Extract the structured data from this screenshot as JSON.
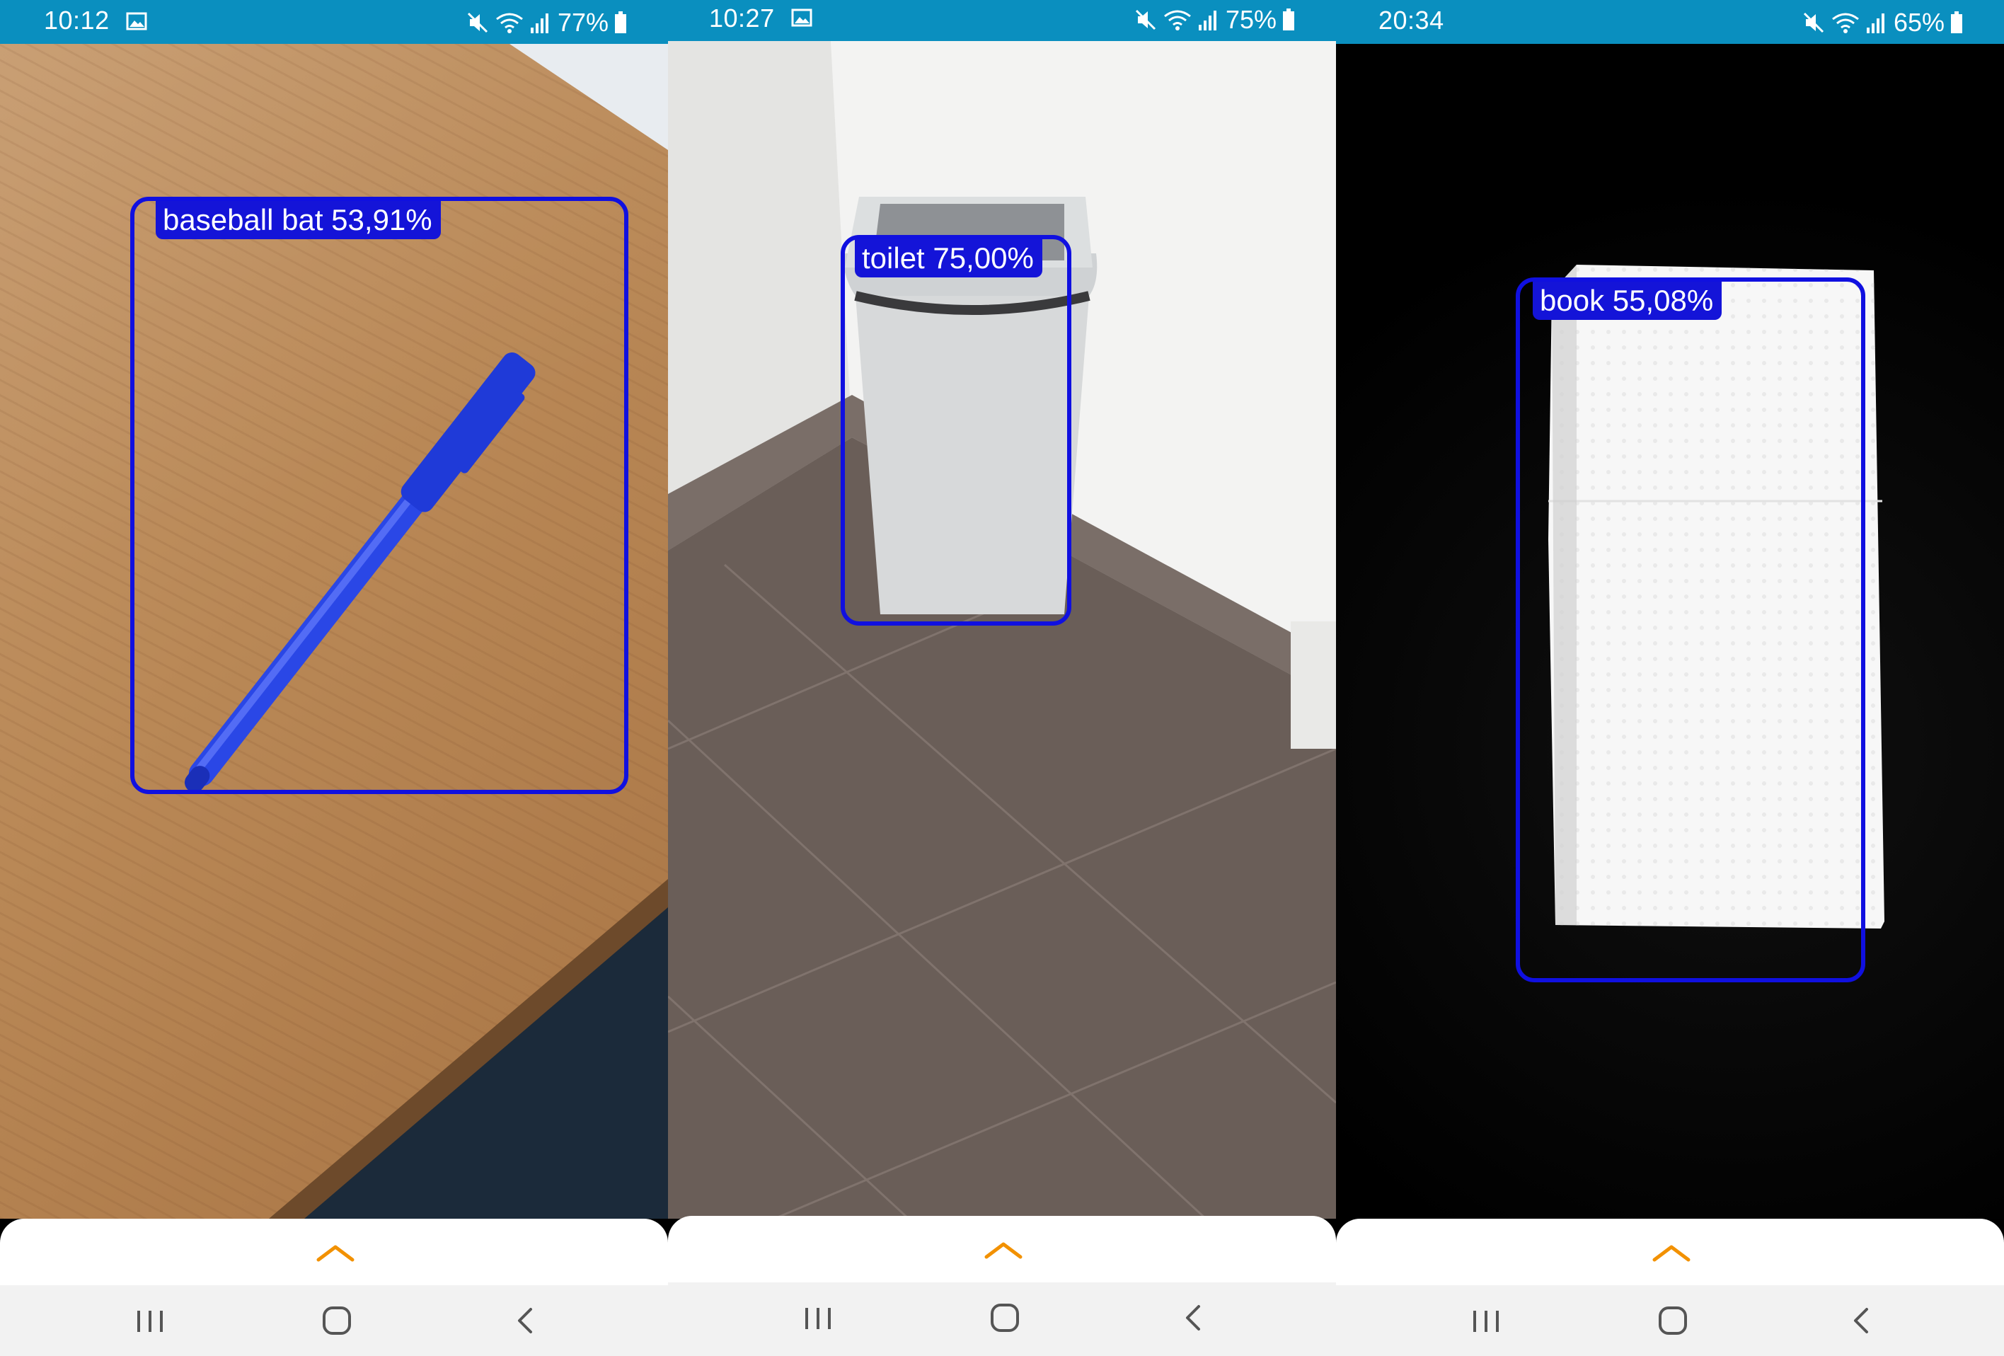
{
  "screens": [
    {
      "status": {
        "time": "10:12",
        "battery": "77%"
      },
      "detection": {
        "label": "baseball bat 53,91%"
      }
    },
    {
      "status": {
        "time": "10:27",
        "battery": "75%"
      },
      "detection": {
        "label": "toilet 75,00%"
      }
    },
    {
      "status": {
        "time": "20:34",
        "battery": "65%"
      },
      "detection": {
        "label": "book 55,08%"
      }
    }
  ],
  "colors": {
    "status_bar": "#0a8fbf",
    "detection_box": "#1010e0",
    "expand_chevron": "#f29100",
    "nav_bar": "#f2f2f2"
  },
  "icons": {
    "status_left": "gallery-icon",
    "status_right": [
      "mute-icon",
      "wifi-icon",
      "signal-icon",
      "battery-icon"
    ],
    "sheet": "chevron-up-icon",
    "nav": [
      "recents-icon",
      "home-icon",
      "back-icon"
    ]
  }
}
